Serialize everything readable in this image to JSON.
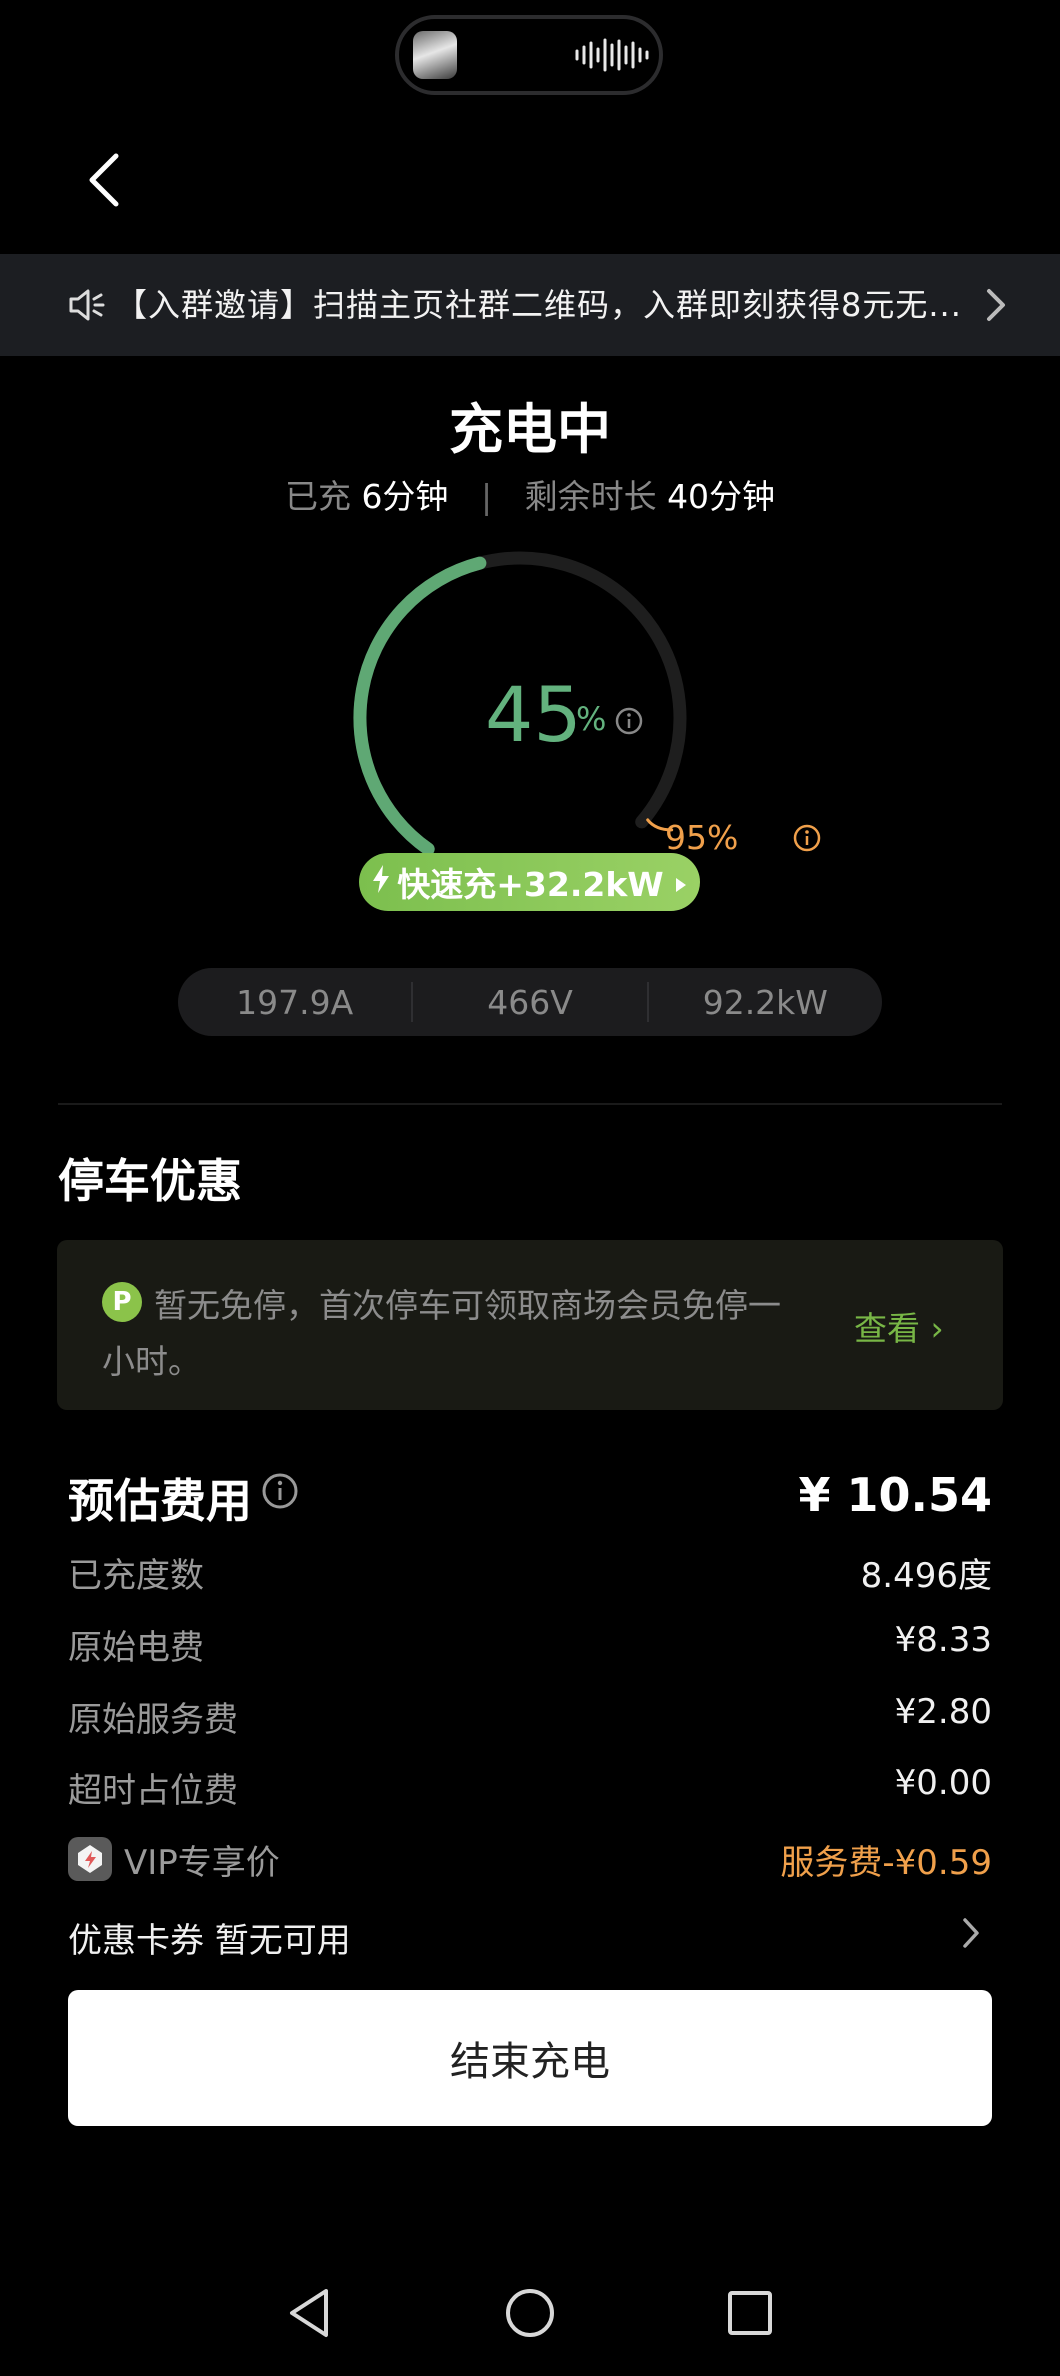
{
  "notice": {
    "text": "【入群邀请】扫描主页社群二维码，入群即刻获得8元无..."
  },
  "status": {
    "title": "充电中",
    "charged_label": "已充",
    "charged_value": "6分钟",
    "remaining_label": "剩余时长",
    "remaining_value": "40分钟"
  },
  "gauge": {
    "percent": "45",
    "percent_unit": "%",
    "progress_fraction": 0.45,
    "target_label": "95%",
    "target_fraction": 0.95,
    "progress_color": "#5fa874",
    "track_color": "#1e1e1e"
  },
  "fast_charge": {
    "label": "快速充+32.2kW"
  },
  "metrics": {
    "current": "197.9A",
    "voltage": "466V",
    "power": "92.2kW"
  },
  "parking": {
    "heading": "停车优惠",
    "badge": "P",
    "message": "暂无免停，首次停车可领取商场会员免停一小时。",
    "link": "查看 ›"
  },
  "fees": {
    "heading": "预估费用",
    "total": "¥ 10.54",
    "rows": [
      {
        "label": "已充度数",
        "value": "8.496度"
      },
      {
        "label": "原始电费",
        "value": "¥8.33"
      },
      {
        "label": "原始服务费",
        "value": "¥2.80"
      },
      {
        "label": "超时占位费",
        "value": "¥0.00"
      },
      {
        "label": "VIP专享价",
        "value": "服务费-¥0.59"
      }
    ],
    "coupon": "优惠卡券 暂无可用"
  },
  "end_button": "结束充电",
  "colors": {
    "accent_green": "#63b27e",
    "orange": "#f0a04b",
    "lime": "#78b646"
  }
}
